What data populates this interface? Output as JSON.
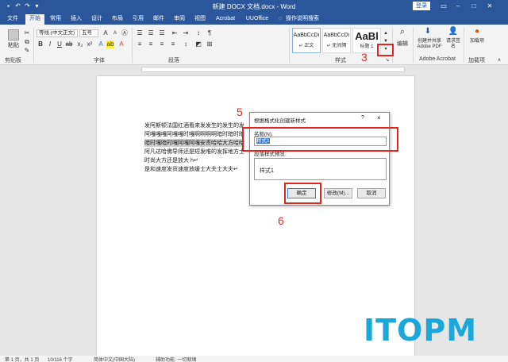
{
  "window": {
    "title": "新建 DOCX 文档.docx - Word",
    "signin": "登录"
  },
  "tabs": [
    "文件",
    "开始",
    "常用",
    "插入",
    "设计",
    "布局",
    "引用",
    "邮件",
    "审阅",
    "视图",
    "Acrobat",
    "UUOffice",
    "操作说明搜索"
  ],
  "ribbon": {
    "paste_label": "粘贴",
    "font_name": "等线 (中文正文)",
    "font_size": "五号",
    "groups": {
      "clipboard": "剪贴板",
      "font": "字体",
      "paragraph": "段落",
      "styles": "样式",
      "acrobat": "Adobe Acrobat",
      "addins": "加载项"
    },
    "styles": [
      {
        "preview": "AaBbCcDı",
        "name": "↵ 正文"
      },
      {
        "preview": "AaBbCcDı",
        "name": "↵ 无间隔"
      },
      {
        "preview": "AaBl",
        "name": "标题 1"
      }
    ],
    "edit_label": "编辑",
    "acrobat_btn1": "创建并共享 Adobe PDF",
    "acrobat_btn2": "请求签名",
    "addin_btn": "加载项"
  },
  "document": {
    "lines": [
      "发阿斯顿法国红酒看来发发生的发生的发",
      "阿嘎嘎嘎阿嘎嘎时嘎啊啊啊啊暗时暗时暗",
      "暗时嘎暗时嘎阿嘎阿嘎安责哈哈大方哈哈",
      "阿凡达哈佛导师还是短发唯的发挥地方士",
      "时尚大方还是放大 h↵",
      "是和速度发货速度放缓士大夫士大夫↵"
    ]
  },
  "dialog": {
    "title": "根据格式化创建新样式",
    "help": "?",
    "close": "×",
    "name_label": "名称(N):",
    "name_value": "样式1",
    "preview_label": "段落样式预览:",
    "preview_text": "样式1",
    "ok": "确定",
    "modify": "修改(M)...",
    "cancel": "取消"
  },
  "annotations": {
    "step3": "3",
    "step5": "5",
    "step6": "6"
  },
  "watermark": "ITOPM",
  "statusbar": {
    "page": "第 1 页，共 1 页",
    "words": "10/116 个字",
    "language": "简体中文(中国大陆)",
    "accessibility": "辅助功能: 一切就绪"
  },
  "colors": {
    "accent": "#2b579a",
    "annotation_red": "#e0271f",
    "watermark": "#1aa7d9"
  }
}
